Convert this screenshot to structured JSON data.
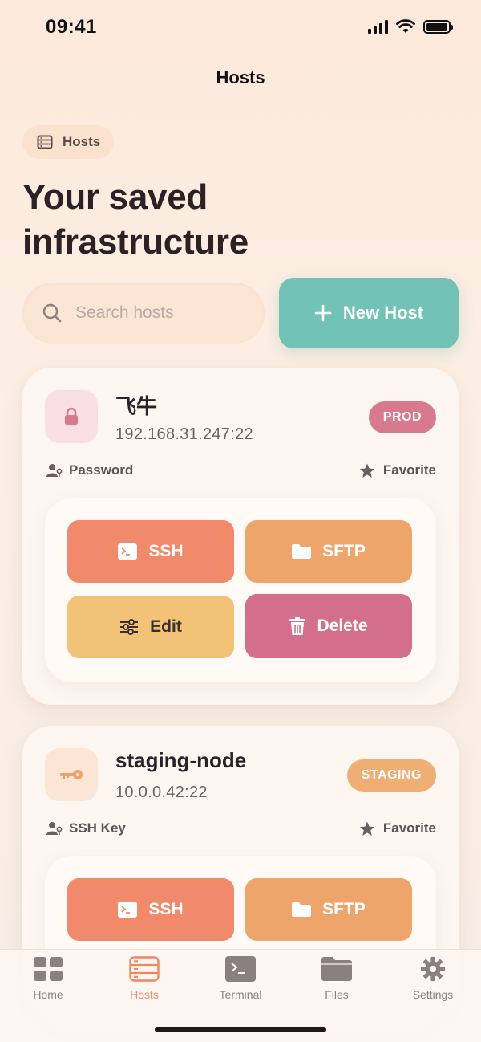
{
  "status_bar": {
    "time": "09:41"
  },
  "nav": {
    "title": "Hosts"
  },
  "chip": {
    "label": "Hosts",
    "icon": "server-icon"
  },
  "headline": {
    "line1": "Your saved",
    "line2": "infrastructure"
  },
  "search": {
    "placeholder": "Search hosts",
    "value": ""
  },
  "new_host_button": {
    "label": "New Host",
    "icon": "plus-icon"
  },
  "hosts": [
    {
      "name": "飞牛",
      "address": "192.168.31.247:22",
      "environment": "PROD",
      "auth": "Password",
      "favorite_label": "Favorite",
      "icon": "lock-icon",
      "actions": {
        "ssh": "SSH",
        "sftp": "SFTP",
        "edit": "Edit",
        "delete": "Delete"
      }
    },
    {
      "name": "staging-node",
      "address": "10.0.0.42:22",
      "environment": "STAGING",
      "auth": "SSH Key",
      "favorite_label": "Favorite",
      "icon": "key-icon",
      "actions": {
        "ssh": "SSH",
        "sftp": "SFTP"
      }
    }
  ],
  "tabs": [
    {
      "label": "Home",
      "icon": "grid-icon",
      "active": false
    },
    {
      "label": "Hosts",
      "icon": "server-icon",
      "active": true
    },
    {
      "label": "Terminal",
      "icon": "terminal-icon",
      "active": false
    },
    {
      "label": "Files",
      "icon": "folder-icon",
      "active": false
    },
    {
      "label": "Settings",
      "icon": "gear-icon",
      "active": false
    }
  ],
  "colors": {
    "accent": "#ef8761",
    "new_host": "#72c2b7",
    "ssh": "#f08a6b",
    "sftp": "#eea56b",
    "edit": "#f2c276",
    "delete": "#d36f8d",
    "prod_badge": "#d8798d",
    "staging_badge": "#efae74"
  }
}
